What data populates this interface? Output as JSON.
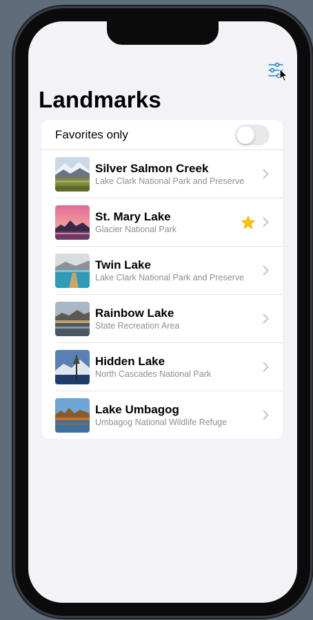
{
  "header": {
    "title": "Landmarks"
  },
  "favorites_filter": {
    "label": "Favorites only",
    "enabled": false
  },
  "landmarks": [
    {
      "name": "Silver Salmon Creek",
      "park": "Lake Clark National Park and Preserve",
      "favorite": false
    },
    {
      "name": "St. Mary Lake",
      "park": "Glacier National Park",
      "favorite": true
    },
    {
      "name": "Twin Lake",
      "park": "Lake Clark National Park and Preserve",
      "favorite": false
    },
    {
      "name": "Rainbow Lake",
      "park": "State Recreation Area",
      "favorite": false
    },
    {
      "name": "Hidden Lake",
      "park": "North Cascades National Park",
      "favorite": false
    },
    {
      "name": "Lake Umbagog",
      "park": "Umbagog National Wildlife Refuge",
      "favorite": false
    }
  ],
  "icons": {
    "filter": "slider-horizontal-icon",
    "favorite": "star-fill-icon",
    "disclosure": "chevron-right-icon"
  },
  "colors": {
    "accent": "#1a84c7",
    "star": "#f8c40f",
    "background": "#f2f2f7"
  }
}
